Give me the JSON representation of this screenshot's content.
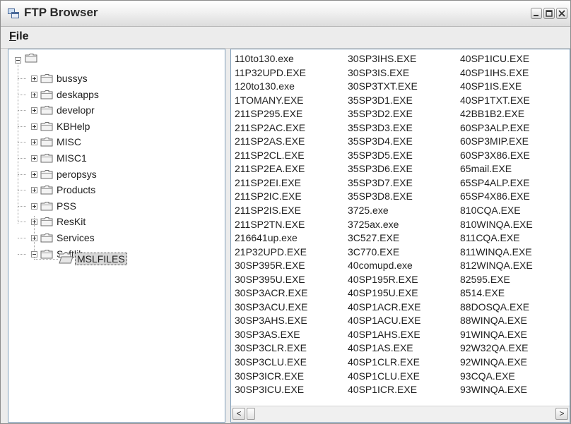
{
  "window": {
    "title": "FTP Browser"
  },
  "menu": {
    "file_accel": "F",
    "file_rest": "ile"
  },
  "tree": {
    "items": [
      {
        "label": "bussys"
      },
      {
        "label": "deskapps"
      },
      {
        "label": "developr"
      },
      {
        "label": "KBHelp"
      },
      {
        "label": "MISC"
      },
      {
        "label": "MISC1"
      },
      {
        "label": "peropsys"
      },
      {
        "label": "Products"
      },
      {
        "label": "PSS"
      },
      {
        "label": "ResKit"
      },
      {
        "label": "Services"
      },
      {
        "label": "Softlib"
      }
    ],
    "selected_child": "MSLFILES"
  },
  "files": {
    "col1": [
      "110to130.exe",
      "11P32UPD.EXE",
      "120to130.exe",
      "1TOMANY.EXE",
      "211SP295.EXE",
      "211SP2AC.EXE",
      "211SP2AS.EXE",
      "211SP2CL.EXE",
      "211SP2EA.EXE",
      "211SP2EI.EXE",
      "211SP2IC.EXE",
      "211SP2IS.EXE",
      "211SP2TN.EXE",
      "216641up.exe",
      "21P32UPD.EXE",
      "30SP395R.EXE",
      "30SP395U.EXE",
      "30SP3ACR.EXE",
      "30SP3ACU.EXE",
      "30SP3AHS.EXE",
      "30SP3AS.EXE",
      "30SP3CLR.EXE",
      "30SP3CLU.EXE",
      "30SP3ICR.EXE",
      "30SP3ICU.EXE"
    ],
    "col2": [
      "30SP3IHS.EXE",
      "30SP3IS.EXE",
      "30SP3TXT.EXE",
      "35SP3D1.EXE",
      "35SP3D2.EXE",
      "35SP3D3.EXE",
      "35SP3D4.EXE",
      "35SP3D5.EXE",
      "35SP3D6.EXE",
      "35SP3D7.EXE",
      "35SP3D8.EXE",
      "3725.exe",
      "3725ax.exe",
      "3C527.EXE",
      "3C770.EXE",
      "40comupd.exe",
      "40SP195R.EXE",
      "40SP195U.EXE",
      "40SP1ACR.EXE",
      "40SP1ACU.EXE",
      "40SP1AHS.EXE",
      "40SP1AS.EXE",
      "40SP1CLR.EXE",
      "40SP1CLU.EXE",
      "40SP1ICR.EXE"
    ],
    "col3": [
      "40SP1ICU.EXE",
      "40SP1IHS.EXE",
      "40SP1IS.EXE",
      "40SP1TXT.EXE",
      "42BB1B2.EXE",
      "60SP3ALP.EXE",
      "60SP3MIP.EXE",
      "60SP3X86.EXE",
      "65mail.EXE",
      "65SP4ALP.EXE",
      "65SP4X86.EXE",
      "810CQA.EXE",
      "810WINQA.EXE",
      "811CQA.EXE",
      "811WINQA.EXE",
      "812WINQA.EXE",
      "82595.EXE",
      "8514.EXE",
      "88DOSQA.EXE",
      "88WINQA.EXE",
      "91WINQA.EXE",
      "92W32QA.EXE",
      "92WINQA.EXE",
      "93CQA.EXE",
      "93WINQA.EXE"
    ]
  },
  "scrollbar": {
    "left_arrow": "<",
    "right_arrow": ">"
  }
}
